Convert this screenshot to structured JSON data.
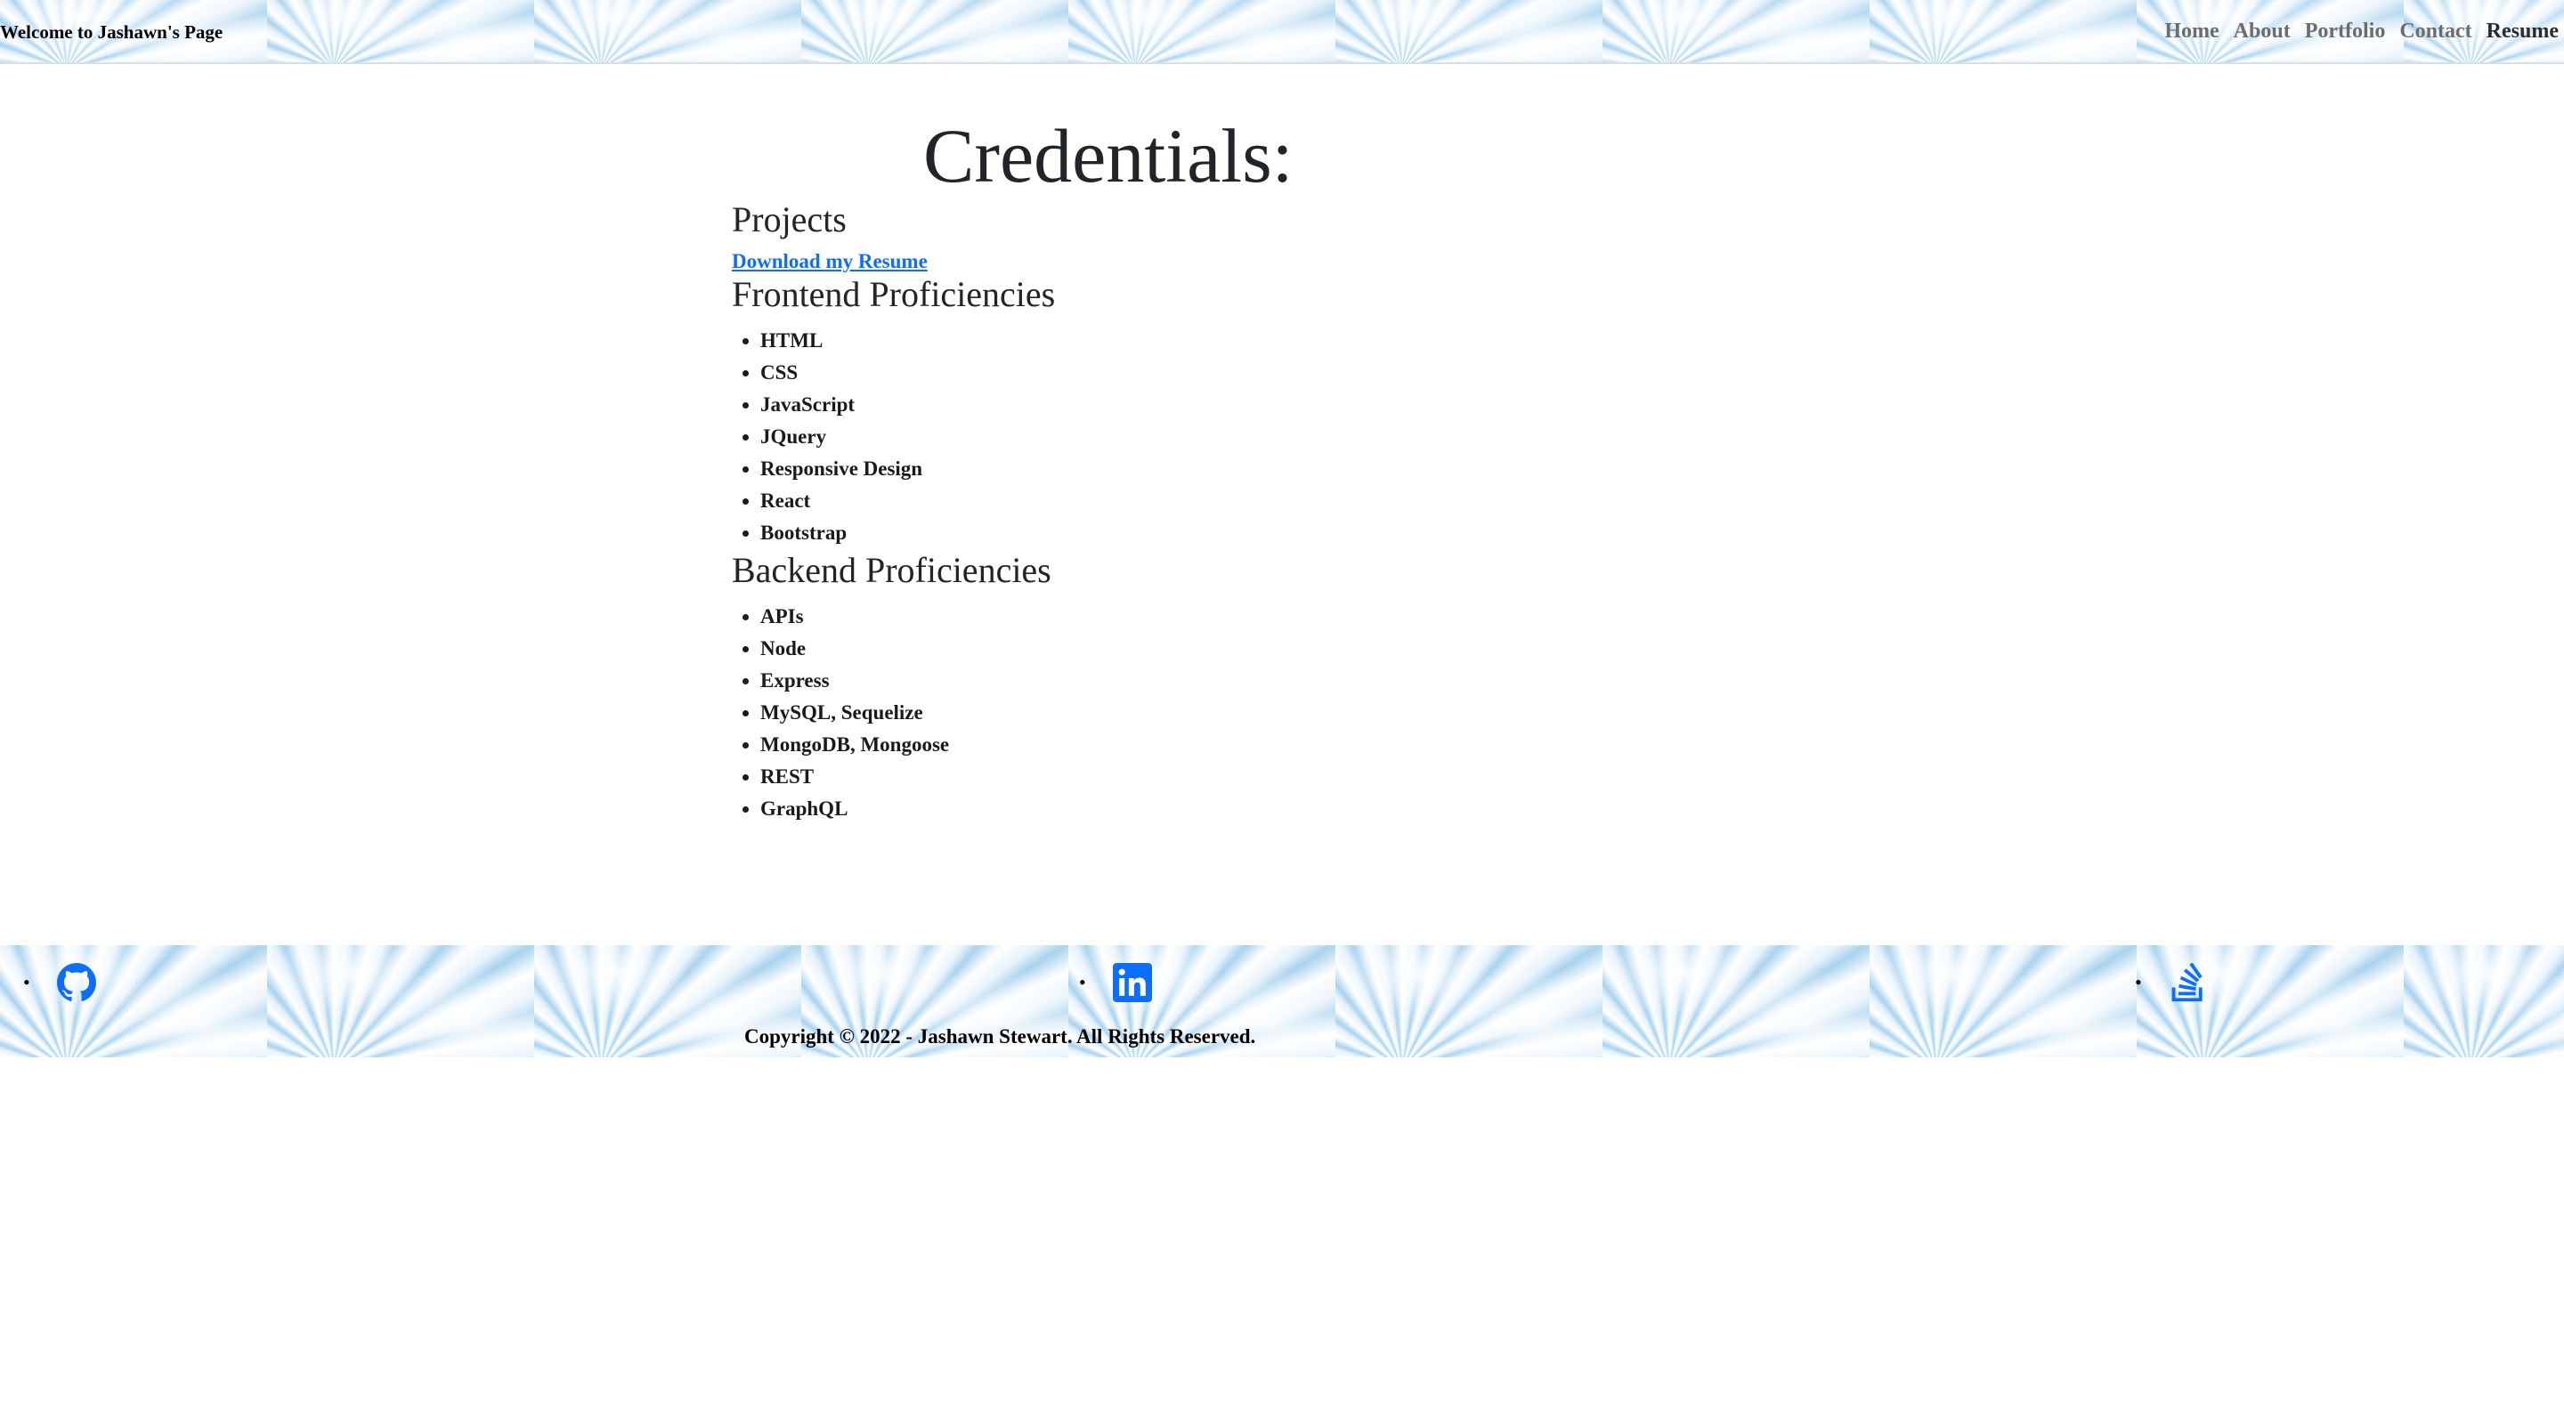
{
  "header": {
    "brand": "Welcome to Jashawn's Page",
    "nav": [
      "Home",
      "About",
      "Portfolio",
      "Contact",
      "Resume"
    ],
    "active": "Resume"
  },
  "main": {
    "title": "Credentials:",
    "projects_heading": "Projects",
    "resume_link": "Download my Resume",
    "frontend_heading": "Frontend Proficiencies",
    "frontend_skills": [
      "HTML",
      "CSS",
      "JavaScript",
      "JQuery",
      "Responsive Design",
      "React",
      "Bootstrap"
    ],
    "backend_heading": "Backend Proficiencies",
    "backend_skills": [
      "APIs",
      "Node",
      "Express",
      "MySQL, Sequelize",
      "MongoDB, Mongoose",
      "REST",
      "GraphQL"
    ]
  },
  "footer": {
    "social_icons": [
      "github-icon",
      "linkedin-icon",
      "stackoverflow-icon"
    ],
    "copyright": "Copyright © 2022 - Jashawn Stewart. All Rights Reserved."
  },
  "colors": {
    "link": "#0d6efd",
    "nav_text": "#6c6c6c",
    "text": "#212529"
  }
}
